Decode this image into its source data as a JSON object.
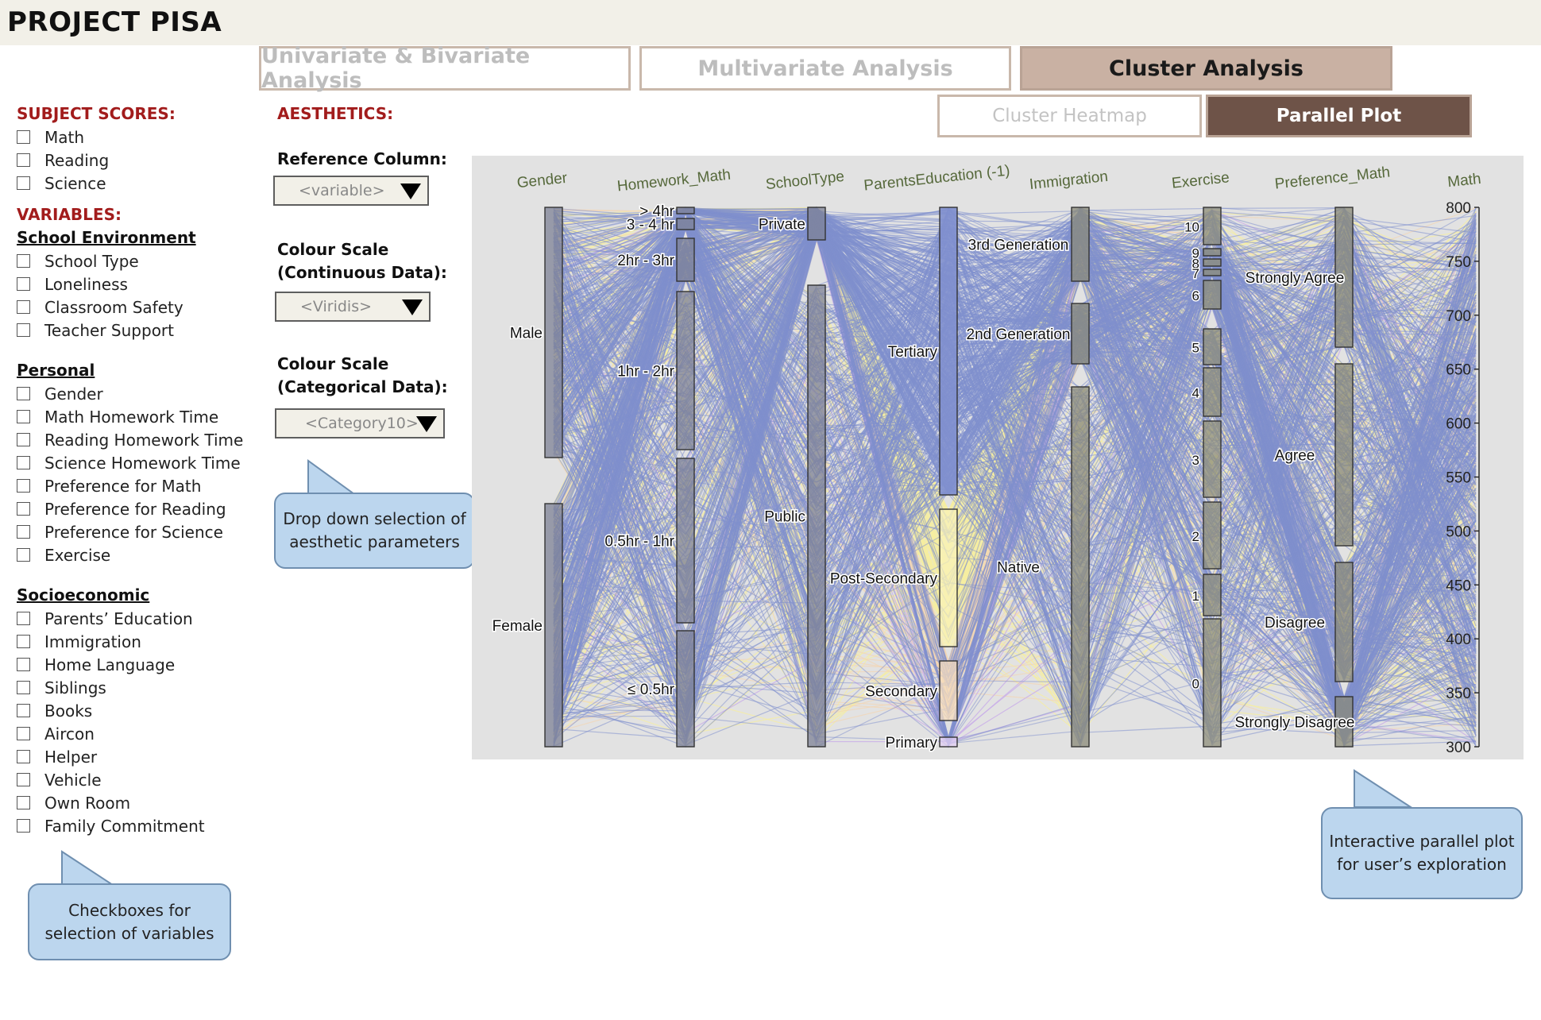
{
  "app": {
    "title": "PROJECT PISA"
  },
  "tabs": [
    {
      "label": "Univariate & Bivariate Analysis",
      "active": false
    },
    {
      "label": "Multivariate Analysis",
      "active": false
    },
    {
      "label": "Cluster Analysis",
      "active": true
    }
  ],
  "subtabs": [
    {
      "label": "Cluster Heatmap",
      "active": false
    },
    {
      "label": "Parallel Plot",
      "active": true
    }
  ],
  "sidebar": {
    "subject_title": "SUBJECT SCORES:",
    "subjects": [
      "Math",
      "Reading",
      "Science"
    ],
    "variables_title": "VARIABLES:",
    "groups": [
      {
        "title": "School Environment",
        "items": [
          "School Type",
          "Loneliness",
          "Classroom Safety",
          "Teacher Support"
        ]
      },
      {
        "title": "Personal",
        "items": [
          "Gender",
          "Math Homework Time",
          "Reading Homework Time",
          "Science Homework Time",
          "Preference for Math",
          "Preference for Reading",
          "Preference for Science",
          "Exercise"
        ]
      },
      {
        "title": "Socioeconomic",
        "items": [
          "Parents’ Education",
          "Immigration",
          "Home Language",
          "Siblings",
          "Books",
          "Aircon",
          "Helper",
          "Vehicle",
          "Own Room",
          "Family Commitment"
        ]
      }
    ]
  },
  "aesthetics": {
    "title": "AESTHETICS:",
    "reference_label": "Reference Column:",
    "reference_value": "<variable>",
    "continuous_label_1": "Colour Scale",
    "continuous_label_2": "(Continuous Data):",
    "continuous_value": "<Viridis>",
    "categorical_label_1": "Colour Scale",
    "categorical_label_2": "(Categorical Data):",
    "categorical_value": "<Category10>"
  },
  "callouts": {
    "dropdown": [
      "Drop down selection of",
      "aesthetic parameters"
    ],
    "checkbox": [
      "Checkboxes for",
      "selection of variables"
    ],
    "plot": [
      "Interactive parallel plot",
      "for user’s exploration"
    ]
  },
  "chart_data": {
    "type": "parallel_coordinates",
    "axes": [
      "Gender",
      "Homework_Math",
      "SchoolType",
      "ParentsEducation (-1)",
      "Immigration",
      "Exercise",
      "Preference_Math",
      "Math"
    ],
    "categories": {
      "Gender": [
        "Male",
        "Female"
      ],
      "Homework_Math": [
        "> 4hr",
        "3 - 4 hr",
        "2hr - 3hr",
        "1hr - 2hr",
        "0.5hr - 1hr",
        "≤ 0.5hr"
      ],
      "SchoolType": [
        "Private",
        "Public"
      ],
      "ParentsEducation (-1)": [
        "Tertiary",
        "Post-Secondary",
        "Secondary",
        "Primary"
      ],
      "Immigration": [
        "3rd Generation",
        "2nd Generation",
        "Native"
      ],
      "Exercise": [
        "10",
        "9",
        "8",
        "7",
        "6",
        "5",
        "4",
        "3",
        "2",
        "1",
        "0"
      ],
      "Preference_Math": [
        "Strongly Agree",
        "Agree",
        "Disagree",
        "Strongly Disagree"
      ]
    },
    "math_axis": {
      "ticks": [
        "800",
        "750",
        "700",
        "650",
        "600",
        "550",
        "500",
        "450",
        "400",
        "350",
        "300"
      ],
      "range": [
        300,
        800
      ]
    },
    "line_colors": {
      "blue": "#7f8fce",
      "yellow": "#f6eda0",
      "orange": "#f4d6b4",
      "purple": "#c9aee8"
    }
  }
}
